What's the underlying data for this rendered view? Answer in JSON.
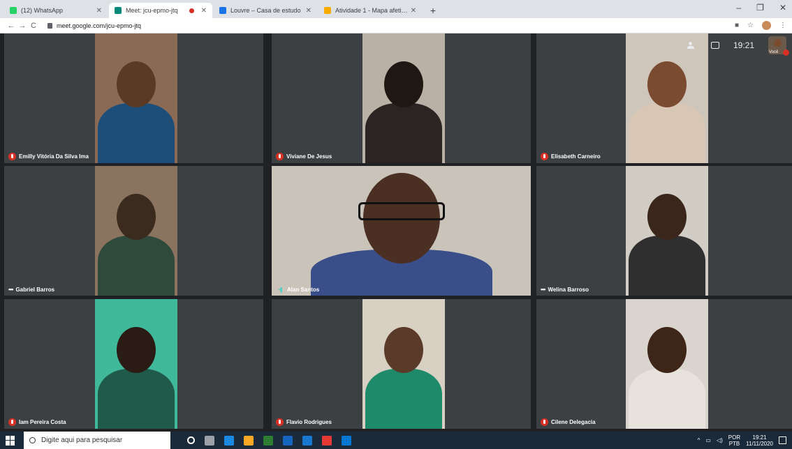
{
  "browser": {
    "tabs": [
      {
        "label": "(12) WhatsApp",
        "favicon_color": "#25d366",
        "active": false,
        "recording": false
      },
      {
        "label": "Meet: jcu-epmo-jtq",
        "favicon_color": "#00897b",
        "active": true,
        "recording": true
      },
      {
        "label": "Louvre – Casa de estudo",
        "favicon_color": "#1a73e8",
        "active": false,
        "recording": false
      },
      {
        "label": "Atividade 1 - Mapa afetivo",
        "favicon_color": "#f9ab00",
        "active": false,
        "recording": false
      }
    ],
    "new_tab_label": "+",
    "url": "meet.google.com/jcu-epmo-jtq",
    "back_icon": "←",
    "forward_icon": "→",
    "reload_icon": "C",
    "window_controls": [
      "–",
      "❐",
      "✕"
    ]
  },
  "meet": {
    "clock": "19:21",
    "self_label": "Você",
    "participants": [
      {
        "name": "Emilly Vitória Da Silva Ima",
        "status": "muted",
        "skin": "#5a3a25",
        "shirt": "#1d4e7a",
        "bg": "#8a6a55"
      },
      {
        "name": "Viviane De Jesus",
        "status": "muted",
        "skin": "#1f1712",
        "shirt": "#2a2522",
        "bg": "#b9b1a6"
      },
      {
        "name": "Elisabeth Carneiro",
        "status": "muted",
        "skin": "#7a4b30",
        "shirt": "#d9c7b5",
        "bg": "#cfc6bb"
      },
      {
        "name": "Gabriel Barros",
        "status": "more",
        "skin": "#3b2a1e",
        "shirt": "#2f4a3a",
        "bg": "#8a7460"
      },
      {
        "name": "Alan Santos",
        "status": "speaking",
        "skin": "#4a2f22",
        "shirt": "#3a4f8a",
        "bg": "#c9c3b9"
      },
      {
        "name": "Welina Barroso",
        "status": "more",
        "skin": "#3a261b",
        "shirt": "#2f2f2f",
        "bg": "#d2cdc4"
      },
      {
        "name": "Iam Pereira Costa",
        "status": "muted",
        "skin": "#2a1c14",
        "shirt": "#1f5a4a",
        "bg": "#3fb99a"
      },
      {
        "name": "Flavio Rodrigues",
        "status": "muted",
        "skin": "#5a3a28",
        "shirt": "#1f8a6a",
        "bg": "#d8d0c2"
      },
      {
        "name": "Cilene Delegacia",
        "status": "muted",
        "skin": "#3d2618",
        "shirt": "#e8e2dc",
        "bg": "#d9d4cd"
      }
    ]
  },
  "taskbar": {
    "search_placeholder": "Digite aqui para pesquisar",
    "lang_top": "POR",
    "lang_bottom": "PTB",
    "time": "19:21",
    "date": "11/11/2020",
    "app_icon_colors": [
      "#ffffff",
      "#9aa0a6",
      "#1e88e5",
      "#f9a825",
      "#2e7d32",
      "#1565c0",
      "#1976d2",
      "#e53935",
      "#0078d4"
    ]
  }
}
